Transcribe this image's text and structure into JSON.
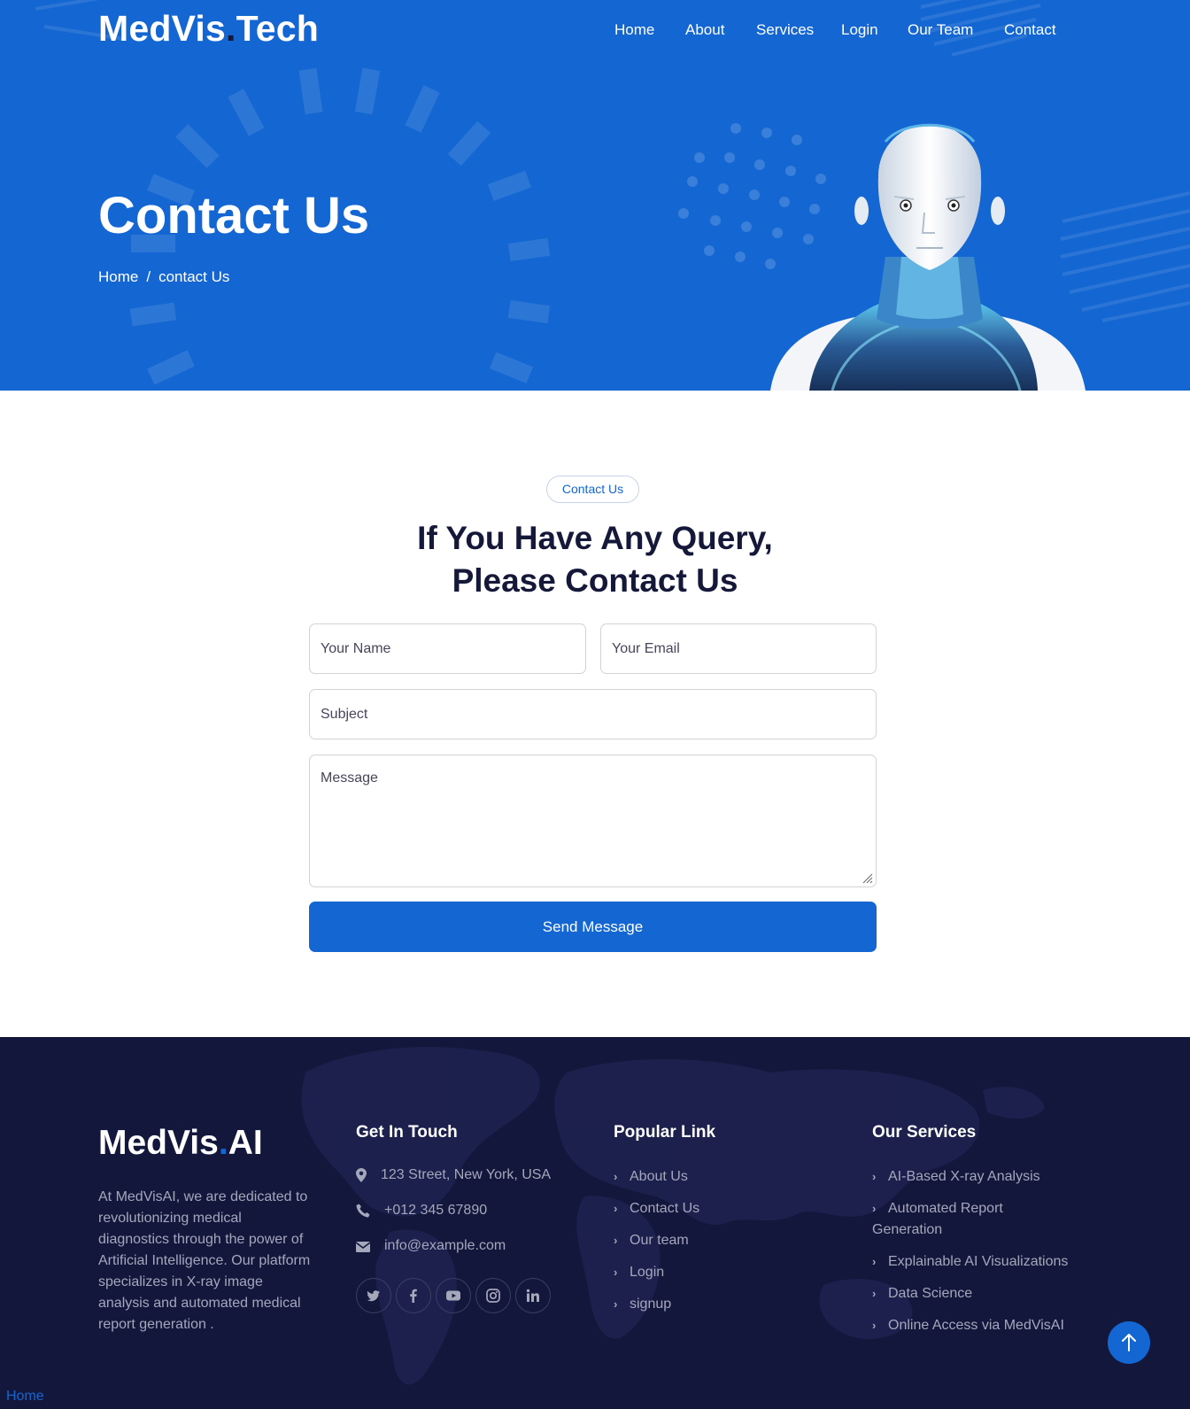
{
  "header": {
    "brand_main": "MedVis",
    "brand_dot": ".",
    "brand_suffix": "Tech",
    "nav": [
      "Home",
      "About",
      "Services",
      "Login",
      "Our Team",
      "Contact"
    ]
  },
  "hero": {
    "title": "Contact Us",
    "breadcrumb": [
      "Home",
      "/",
      "contact Us"
    ]
  },
  "contact": {
    "badge": "Contact Us",
    "title_line1": "If You Have Any Query,",
    "title_line2": "Please Contact Us",
    "form": {
      "name_placeholder": "Your Name",
      "email_placeholder": "Your Email",
      "subject_placeholder": "Subject",
      "message_placeholder": "Message",
      "submit_label": "Send Message"
    }
  },
  "footer": {
    "brand_main": "MedVis",
    "brand_dot": ".",
    "brand_suffix": "AI",
    "about": "At MedVisAI, we are dedicated to revolutionizing medical diagnostics through the power of Artificial Intelligence. Our platform specializes in X-ray image analysis and automated medical report generation .",
    "get_in_touch": {
      "heading": "Get In Touch",
      "address": "123 Street, New York, USA",
      "phone": "+012 345 67890",
      "email": "info@example.com"
    },
    "social": [
      "twitter-icon",
      "facebook-icon",
      "youtube-icon",
      "instagram-icon",
      "linkedin-icon"
    ],
    "popular_links": {
      "heading": "Popular Link",
      "items": [
        "About Us",
        "Contact Us",
        "Our team",
        "Login",
        "signup"
      ]
    },
    "services": {
      "heading": "Our Services",
      "items": [
        "AI-Based X-ray Analysis",
        "Automated Report Generation",
        "Explainable AI Visualizations",
        "Data Science",
        "Online Access via MedVisAI"
      ]
    },
    "bottom_link": "Home"
  },
  "colors": {
    "primary": "#1466d2",
    "dark": "#14173c",
    "heading": "#16183a"
  }
}
